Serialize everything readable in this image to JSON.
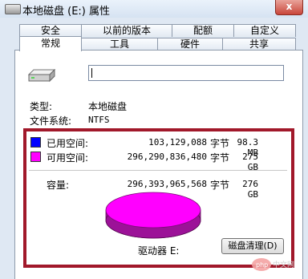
{
  "window": {
    "title": "本地磁盘 (E:) 属性",
    "close_label": "x"
  },
  "tabs": {
    "row1": [
      "安全",
      "以前的版本",
      "配额",
      "自定义"
    ],
    "row2": [
      "常规",
      "工具",
      "硬件",
      "共享"
    ],
    "active": "常规"
  },
  "general": {
    "name_value": "",
    "type_label": "类型:",
    "type_value": "本地磁盘",
    "fs_label": "文件系统:",
    "fs_value": "NTFS"
  },
  "space": {
    "used": {
      "label": "已用空间:",
      "bytes": "103,129,088",
      "unit": "字节",
      "size": "98.3 MB",
      "color": "#0000ff"
    },
    "free": {
      "label": "可用空间:",
      "bytes": "296,290,836,480",
      "unit": "字节",
      "size": "275 GB",
      "color": "#ff00ff"
    },
    "capacity": {
      "label": "容量:",
      "bytes": "296,393,965,568",
      "unit": "字节",
      "size": "276 GB"
    },
    "drive_label": "驱动器 E:",
    "cleanup_label": "磁盘清理(D)"
  },
  "watermark": {
    "text": "php"
  }
}
